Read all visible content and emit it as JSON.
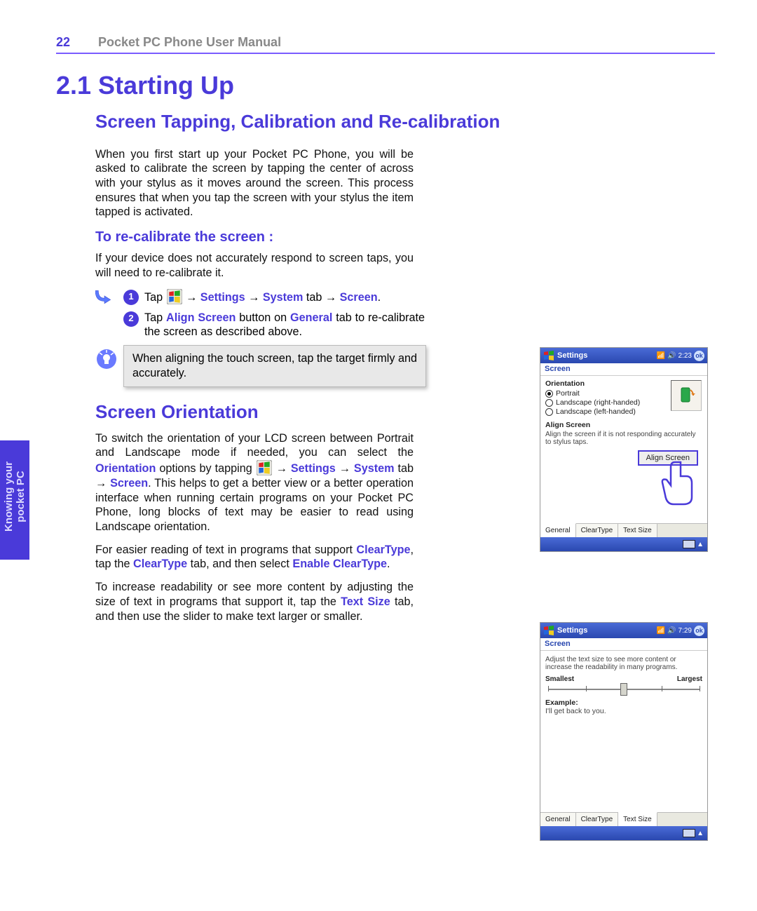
{
  "header": {
    "page_number": "22",
    "manual_title": "Pocket PC Phone User Manual"
  },
  "side_tab": {
    "line1": "Knowing your",
    "line2": "pocket PC"
  },
  "section": {
    "number_title": "2.1 Starting Up",
    "h_calibration": "Screen Tapping, Calibration and Re-calibration",
    "p_calibration": "When you first start up your Pocket PC Phone, you will be asked to calibrate the screen by tapping the center of across with your stylus as it moves around the screen. This process ensures that when you tap the screen with your stylus the item tapped is activated.",
    "h_recalibrate": "To re-calibrate the screen :",
    "p_recalibrate": "If your device does not accurately respond to screen taps, you will need to re-calibrate it.",
    "step1": {
      "prefix": "Tap ",
      "link_settings": "Settings",
      "link_system": "System",
      "mid": " tab → ",
      "link_screen": "Screen",
      "suffix": "."
    },
    "step2": {
      "prefix": "Tap ",
      "link_align": "Align Screen",
      "mid1": " button on ",
      "link_general": "General",
      "suffix": " tab to re-calibrate the screen as described above."
    },
    "tip_text": "When aligning the touch screen, tap the target firmly and accurately.",
    "h_orientation": "Screen Orientation",
    "p_orientation_1a": "To switch the orientation of your LCD screen between Portrait and Landscape mode if needed, you can select the ",
    "p_orientation_1_orientation": "Orientation",
    "p_orientation_1b": " options by tapping ",
    "p_orientation_1_settings": "Settings",
    "p_orientation_1_system": "System",
    "p_orientation_1_mid": " tab → ",
    "p_orientation_1_screen": "Screen",
    "p_orientation_1c": ". This helps to get a better view or a better operation interface when running certain programs on your Pocket PC Phone, long blocks of text may be easier to read using Landscape orientation.",
    "p_cleartype_a": "For easier reading of text in programs that support ",
    "p_cleartype_ct1": "ClearType",
    "p_cleartype_b": ", tap the ",
    "p_cleartype_ct2": "ClearType",
    "p_cleartype_c": " tab, and then select ",
    "p_cleartype_enable": "Enable ClearType",
    "p_cleartype_d": ".",
    "p_textsize_a": "To increase readability or see more content by adjusting the size of text in programs that support it, tap the ",
    "p_textsize_ts": "Text Size",
    "p_textsize_b": " tab, and then use the slider to make text larger or smaller."
  },
  "device1": {
    "title": "Settings",
    "time": "2:23",
    "subtitle": "Screen",
    "group_label": "Orientation",
    "radio_portrait": "Portrait",
    "radio_landscape_r": "Landscape (right-handed)",
    "radio_landscape_l": "Landscape (left-handed)",
    "align_label": "Align Screen",
    "align_desc": "Align the screen if it is not responding accurately to stylus taps.",
    "align_button": "Align Screen",
    "tabs": [
      "General",
      "ClearType",
      "Text Size"
    ]
  },
  "device2": {
    "title": "Settings",
    "time": "7:29",
    "subtitle": "Screen",
    "desc": "Adjust the text size to see more content or increase the readability in many programs.",
    "smallest": "Smallest",
    "largest": "Largest",
    "example_label": "Example:",
    "example_text": "I'll get back to you.",
    "tabs": [
      "General",
      "ClearType",
      "Text Size"
    ]
  }
}
